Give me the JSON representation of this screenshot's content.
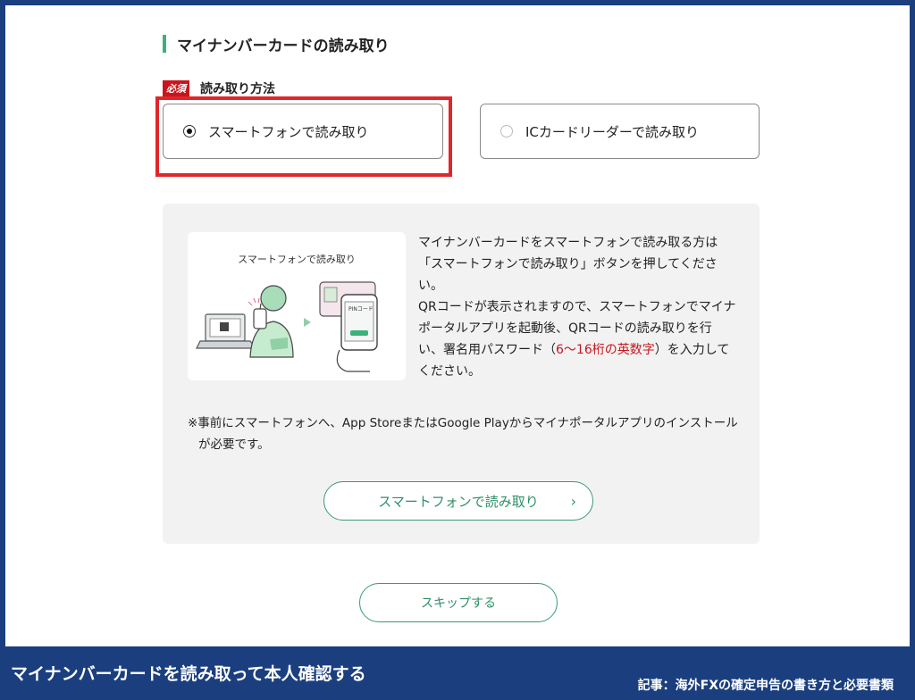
{
  "section": {
    "title": "マイナンバーカードの読み取り",
    "accent_color": "#3bb27a"
  },
  "method": {
    "required_badge": "必須",
    "label": "読み取り方法",
    "options": [
      {
        "label": "スマートフォンで読み取り",
        "selected": true
      },
      {
        "label": "ICカードリーダーで読み取り",
        "selected": false
      }
    ],
    "highlight_color": "#e0262b"
  },
  "info": {
    "illustration_title": "スマートフォンで読み取り",
    "illustration_card_text": "PINコード",
    "description_1": "マイナンバーカードをスマートフォンで読み取る方は「スマートフォンで読み取り」ボタンを押してください。",
    "description_2": "QRコードが表示されますので、スマートフォンでマイナポータルアプリを起動後、QRコードの読み取りを行い、署名用パスワード（",
    "description_red": "6〜16桁の英数字",
    "description_3": "）を入力してください。",
    "note": "※事前にスマートフォンへ、App StoreまたはGoogle Playからマイナポータルアプリのインストールが必要です。",
    "button_label": "スマートフォンで読み取り",
    "button_chevron": "›"
  },
  "skip": {
    "label": "スキップする"
  },
  "footer": {
    "caption": "マイナンバーカードを読み取って本人確認する",
    "article": "記事：海外FXの確定申告の書き方と必要書類",
    "background": "#1b3f7e"
  }
}
